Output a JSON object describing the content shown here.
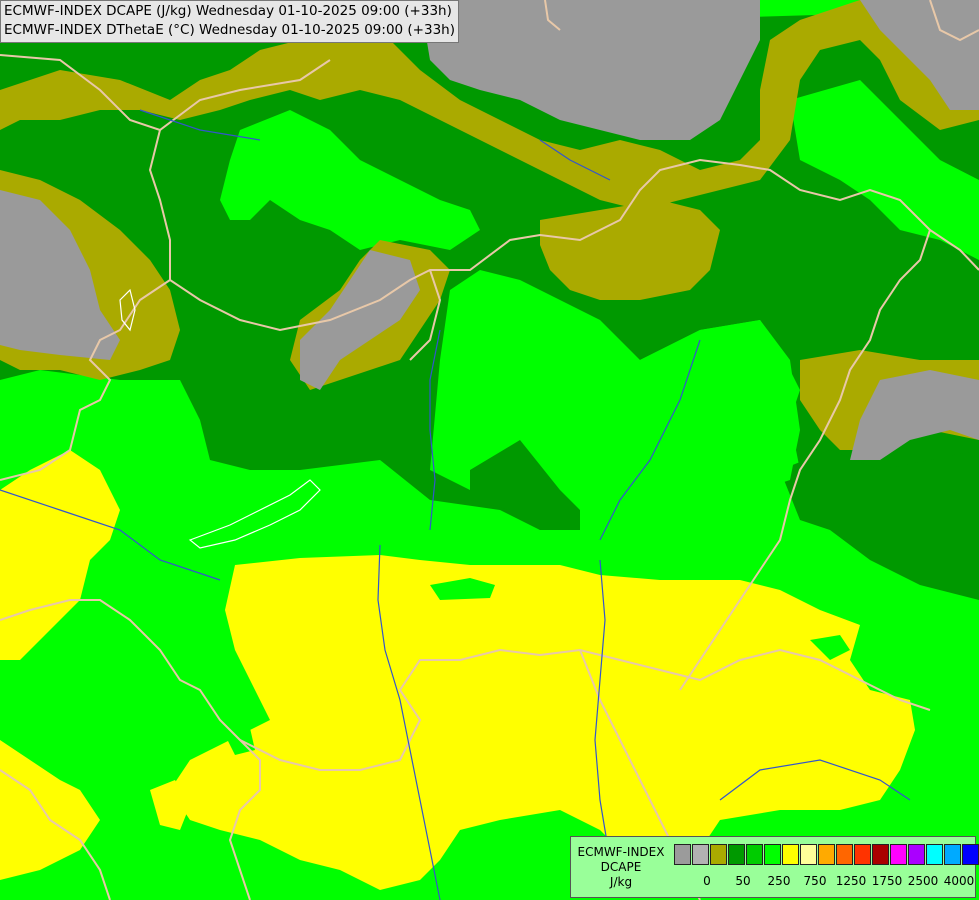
{
  "header": {
    "line1": "ECMWF-INDEX DCAPE (J/kg) Wednesday 01-10-2025 09:00 (+33h)",
    "line2": "ECMWF-INDEX DThetaE (°C) Wednesday 01-10-2025 09:00 (+33h)"
  },
  "colors": {
    "no_data": "#9a9a9a",
    "olive": "#aaaa00",
    "dark_green": "#009900",
    "green": "#00ff00",
    "yellow": "#ffff00",
    "borders": "#e8c8a8",
    "rivers": "#3355cc"
  },
  "legend": {
    "title_line1": "ECMWF-INDEX",
    "title_line2": "DCAPE",
    "unit": "J/kg",
    "swatches": [
      "#9b9b9b",
      "#b2b2b2",
      "#aaaa00",
      "#009900",
      "#00cc00",
      "#00ff00",
      "#ffff00",
      "#ffff99",
      "#ffaa00",
      "#ff6600",
      "#ff3300",
      "#aa0000",
      "#ff00ff",
      "#aa00ff",
      "#00ffff",
      "#00aaff",
      "#0000ff",
      "#000099"
    ],
    "ticks": [
      {
        "label": "0",
        "slot": 1
      },
      {
        "label": "50",
        "slot": 3
      },
      {
        "label": "250",
        "slot": 5
      },
      {
        "label": "750",
        "slot": 7
      },
      {
        "label": "1250",
        "slot": 9
      },
      {
        "label": "1750",
        "slot": 11
      },
      {
        "label": "2500",
        "slot": 13
      },
      {
        "label": "4000",
        "slot": 15
      }
    ]
  }
}
